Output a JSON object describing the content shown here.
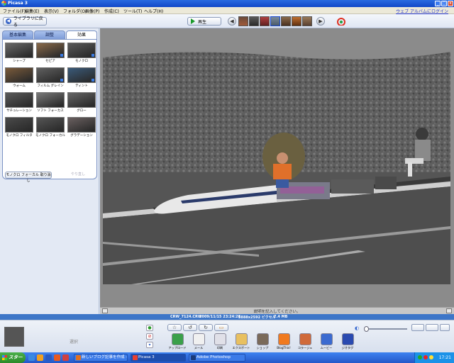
{
  "window": {
    "title": "Picasa 3"
  },
  "menu": {
    "items": [
      "ファイル(F)",
      "編集(E)",
      "表示(V)",
      "フォルダ(O)",
      "画像(P)",
      "作成(C)",
      "ツール(T)",
      "ヘルプ(H)"
    ],
    "login_link": "ウェブ アルバムにログイン"
  },
  "toolbar": {
    "back_label": "ライブラリに戻る",
    "play_label": "再生"
  },
  "edit_panel": {
    "tabs": [
      "基本編集",
      "調整",
      "効果"
    ],
    "active_tab": "効果",
    "effects": [
      {
        "label": "シャープ",
        "color": "#6a6a6a"
      },
      {
        "label": "セピア",
        "color": "#8a6a4a"
      },
      {
        "label": "モノクロ",
        "color": "#5a5a5a"
      },
      {
        "label": "ウォーム",
        "color": "#7a5a3a"
      },
      {
        "label": "フィルム グレイン",
        "color": "#606060"
      },
      {
        "label": "ティント",
        "color": "#3a5a7a"
      },
      {
        "label": "サチュレーション",
        "color": "#5a5a5a"
      },
      {
        "label": "ソフト フォーカス",
        "color": "#7a7a7a"
      },
      {
        "label": "グロー",
        "color": "#666666"
      },
      {
        "label": "モノクロ フィルタ",
        "color": "#4a4a4a"
      },
      {
        "label": "モノクロ フォーカル",
        "color": "#555555"
      },
      {
        "label": "グラデーション",
        "color": "#6a6060"
      }
    ],
    "undo_effect_label": "モノクロ フォーカル 取り消し",
    "redo_label": "やり直し"
  },
  "caption": {
    "placeholder": "説明を記入してください。"
  },
  "info": {
    "filename": "CRW_7124.CRW",
    "datetime": "2009/11/15 23:24:26",
    "dimensions": "3888x2592 ピクセル",
    "size": "7.4 MB"
  },
  "tray": {
    "hold_label": "選択",
    "actions": [
      {
        "label": "アップロード",
        "color": "#3aa04a"
      },
      {
        "label": "メール",
        "color": "#f0f0f0"
      },
      {
        "label": "印刷",
        "color": "#e0e0e8"
      },
      {
        "label": "エクスポート",
        "color": "#e8c060"
      },
      {
        "label": "ショップ",
        "color": "#7a6a5a"
      },
      {
        "label": "BlogThis!",
        "color": "#f07a20"
      },
      {
        "label": "コラージュ",
        "color": "#d06a3a"
      },
      {
        "label": "ムービー",
        "color": "#3a6ad0"
      },
      {
        "label": "ジオタグ",
        "color": "#2a4ab0"
      }
    ]
  },
  "taskbar": {
    "start_label": "スタート",
    "tasks": [
      {
        "label": "新しいブログ記事を作成 - ...",
        "active": false,
        "color": "#e07020"
      },
      {
        "label": "Picasa 3",
        "active": true,
        "color": "#e84030"
      },
      {
        "label": "Adobe Photoshop",
        "active": false,
        "color": "#1a3a7a"
      }
    ],
    "clock": "17:21"
  },
  "colors": {
    "accent": "#3d76c8",
    "title_bar": "#1248c8",
    "panel": "#e3e9f4"
  }
}
